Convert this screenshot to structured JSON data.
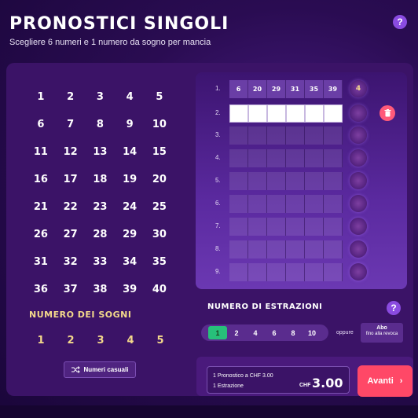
{
  "header": {
    "title": "PRONOSTICI SINGOLI",
    "subtitle": "Scegliere 6 numeri e 1 numero da sogno per mancia",
    "help_label": "?"
  },
  "numbers": [
    "1",
    "2",
    "3",
    "4",
    "5",
    "6",
    "7",
    "8",
    "9",
    "10",
    "11",
    "12",
    "13",
    "14",
    "15",
    "16",
    "17",
    "18",
    "19",
    "20",
    "21",
    "22",
    "23",
    "24",
    "25",
    "26",
    "27",
    "28",
    "29",
    "30",
    "31",
    "32",
    "33",
    "34",
    "35",
    "36",
    "37",
    "38",
    "39",
    "40"
  ],
  "dream": {
    "title": "NUMERO DEI SOGNI",
    "numbers": [
      "1",
      "2",
      "3",
      "4",
      "5"
    ]
  },
  "quick_pick_label": "Numeri casuali",
  "tickets": [
    {
      "index": "1.",
      "numbers": [
        "6",
        "20",
        "29",
        "31",
        "35",
        "39"
      ],
      "dream": "4"
    },
    {
      "index": "2.",
      "numbers": [
        "",
        "",
        "",
        "",
        "",
        ""
      ],
      "dream": ""
    },
    {
      "index": "3.",
      "numbers": [
        "",
        "",
        "",
        "",
        "",
        ""
      ],
      "dream": ""
    },
    {
      "index": "4.",
      "numbers": [
        "",
        "",
        "",
        "",
        "",
        ""
      ],
      "dream": ""
    },
    {
      "index": "5.",
      "numbers": [
        "",
        "",
        "",
        "",
        "",
        ""
      ],
      "dream": ""
    },
    {
      "index": "6.",
      "numbers": [
        "",
        "",
        "",
        "",
        "",
        ""
      ],
      "dream": ""
    },
    {
      "index": "7.",
      "numbers": [
        "",
        "",
        "",
        "",
        "",
        ""
      ],
      "dream": ""
    },
    {
      "index": "8.",
      "numbers": [
        "",
        "",
        "",
        "",
        "",
        ""
      ],
      "dream": ""
    },
    {
      "index": "9.",
      "numbers": [
        "",
        "",
        "",
        "",
        "",
        ""
      ],
      "dream": ""
    }
  ],
  "draws": {
    "title": "NUMERO DI ESTRAZIONI",
    "options": [
      "1",
      "2",
      "4",
      "6",
      "8",
      "10"
    ],
    "selected": "1",
    "or_label": "oppure",
    "abo_label": "Abo",
    "abo_sub": "fino alla revoca"
  },
  "summary": {
    "line1": "1 Pronostico a CHF  3.00",
    "line2": "1 Estrazione",
    "currency": "CHF",
    "total": "3.00",
    "next_label": "Avanti"
  },
  "colors": {
    "accent_green": "#27c07a",
    "cta_red": "#ff4867",
    "dream_gold": "#f4d98b",
    "help_purple": "#8a4be0"
  }
}
